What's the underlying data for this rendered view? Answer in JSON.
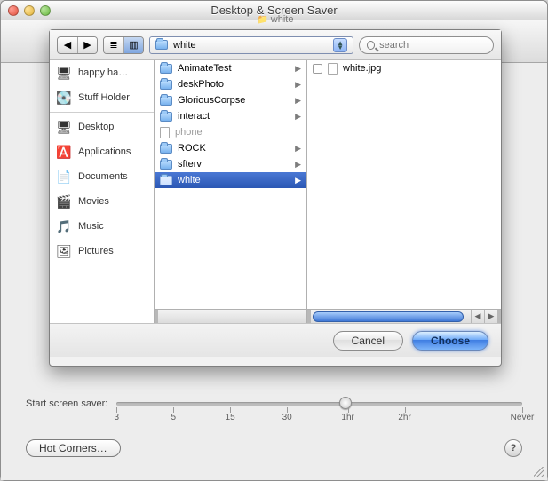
{
  "window_title": "Desktop & Screen Saver",
  "mini_title": "white",
  "sheet": {
    "path_label": "white",
    "search_placeholder": "search",
    "sidebar": {
      "volumes": [
        {
          "label": "happy ha…"
        },
        {
          "label": "Stuff Holder"
        }
      ],
      "places": [
        {
          "label": "Desktop"
        },
        {
          "label": "Applications"
        },
        {
          "label": "Documents"
        },
        {
          "label": "Movies"
        },
        {
          "label": "Music"
        },
        {
          "label": "Pictures"
        }
      ]
    },
    "column1": [
      {
        "label": "AnimateTest",
        "kind": "folder",
        "expand": true
      },
      {
        "label": "deskPhoto",
        "kind": "folder",
        "expand": true
      },
      {
        "label": "GloriousCorpse",
        "kind": "folder",
        "expand": true
      },
      {
        "label": "interact",
        "kind": "folder",
        "expand": true
      },
      {
        "label": "phone",
        "kind": "doc",
        "expand": false,
        "dim": true
      },
      {
        "label": "ROCK",
        "kind": "folder",
        "expand": true
      },
      {
        "label": "sfterv",
        "kind": "folder",
        "expand": true
      },
      {
        "label": "white",
        "kind": "folder",
        "expand": true,
        "selected": true
      }
    ],
    "column2": [
      {
        "label": "white.jpg",
        "kind": "doc"
      }
    ],
    "buttons": {
      "cancel": "Cancel",
      "choose": "Choose"
    }
  },
  "slider": {
    "label": "Start screen saver:",
    "ticks": [
      "3",
      "5",
      "15",
      "30",
      "1hr",
      "2hr",
      "Never"
    ],
    "positions": [
      0,
      14,
      28,
      42,
      57,
      71,
      100
    ],
    "value_index": 4
  },
  "hot_corners_label": "Hot Corners…",
  "help_label": "?"
}
